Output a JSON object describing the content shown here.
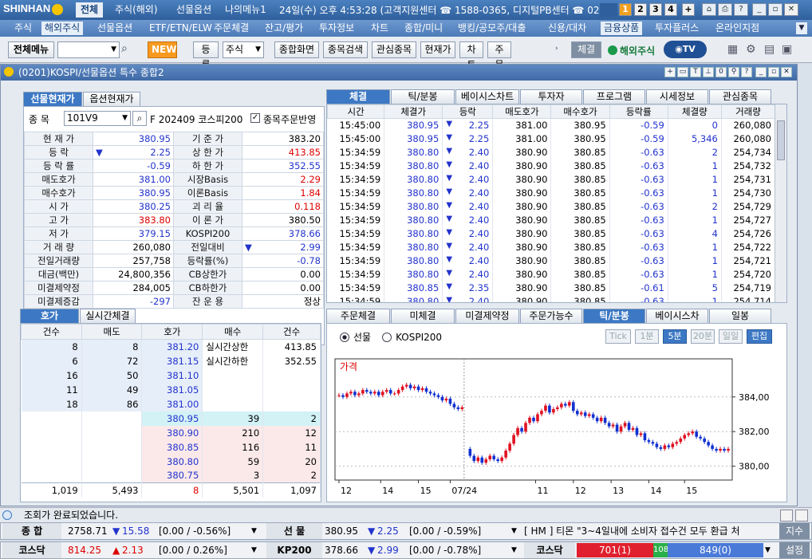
{
  "app": {
    "logo": "SHINHAN",
    "tabs": [
      "전체",
      "주식(해외)",
      "선물옵션",
      "나의메뉴1"
    ],
    "info": "24일(수) 오후 4:53:28 (고객지원센터 ☎ 1588-0365, 디지털PB센터 ☎ 02",
    "pages": [
      "1",
      "2",
      "3",
      "4",
      "+"
    ]
  },
  "menu": [
    "주식",
    "해외주식",
    "선물옵션",
    "ETF/ETN/ELW",
    "주문체결",
    "잔고/평가",
    "투자정보",
    "차트",
    "종합/미니",
    "뱅킹/공모주/대출",
    "신용/대차",
    "금융상품",
    "투자플러스",
    "온라인지점"
  ],
  "toolbar": {
    "all_menu": "전체메뉴",
    "new": "NEW",
    "buttons": [
      "등록",
      "주식",
      "종합화면",
      "종목검색",
      "관심종목",
      "현재가",
      "차트",
      "주문"
    ],
    "right": [
      "체결",
      "해외주식"
    ]
  },
  "window": {
    "title": "(0201)KOSPI/선물옵션 특수 종합2"
  },
  "quote": {
    "tabs": [
      "선물현재가",
      "옵션현재가"
    ],
    "code_label": "종 목",
    "code": "101V9",
    "name": "F 202409 코스피200",
    "checkbox": "종목주문반영",
    "rows": [
      [
        "현 재 가",
        "380.95",
        "dn",
        "기 준 가",
        "383.20",
        ""
      ],
      [
        "등   락",
        "2.25",
        "dn",
        "상 한 가",
        "413.85",
        "up"
      ],
      [
        "등 락 률",
        "-0.59",
        "dn",
        "하 한 가",
        "352.55",
        "dn"
      ],
      [
        "매도호가",
        "381.00",
        "dn",
        "시장Basis",
        "2.29",
        "up"
      ],
      [
        "매수호가",
        "380.95",
        "dn",
        "이론Basis",
        "1.84",
        "up"
      ],
      [
        "시   가",
        "380.25",
        "dn",
        "괴 리 율",
        "0.118",
        "up"
      ],
      [
        "고   가",
        "383.80",
        "up",
        "이 론 가",
        "380.50",
        ""
      ],
      [
        "저   가",
        "379.15",
        "dn",
        "KOSPI200",
        "378.66",
        "dn"
      ],
      [
        "거 래 량",
        "260,080",
        "",
        "전일대비",
        "2.99",
        "dn"
      ],
      [
        "전일거래량",
        "257,758",
        "",
        "등락률(%)",
        "-0.78",
        "dn"
      ],
      [
        "대금(백만)",
        "24,800,356",
        "",
        "CB상한가",
        "0.00",
        ""
      ],
      [
        "미결제약정",
        "284,005",
        "",
        "CB하한가",
        "0.00",
        ""
      ],
      [
        "미결제증감",
        "-297",
        "dn",
        "잔 운 용",
        "정상",
        ""
      ]
    ]
  },
  "ticks": {
    "tabs": [
      "체결",
      "틱/분봉",
      "베이시스차트",
      "투자자",
      "프로그램",
      "시세정보",
      "관심종목"
    ],
    "headers": [
      "시간",
      "체결가",
      "등락",
      "매도호가",
      "매수호가",
      "등락률",
      "체결량",
      "거래량"
    ],
    "rows": [
      [
        "15:45:00",
        "380.95",
        "2.25",
        "381.00",
        "380.95",
        "-0.59",
        "0",
        "260,080"
      ],
      [
        "15:45:00",
        "380.95",
        "2.25",
        "381.00",
        "380.95",
        "-0.59",
        "5,346",
        "260,080"
      ],
      [
        "15:34:59",
        "380.80",
        "2.40",
        "380.90",
        "380.85",
        "-0.63",
        "2",
        "254,734"
      ],
      [
        "15:34:59",
        "380.80",
        "2.40",
        "380.90",
        "380.85",
        "-0.63",
        "1",
        "254,732"
      ],
      [
        "15:34:59",
        "380.80",
        "2.40",
        "380.90",
        "380.85",
        "-0.63",
        "1",
        "254,731"
      ],
      [
        "15:34:59",
        "380.80",
        "2.40",
        "380.90",
        "380.85",
        "-0.63",
        "1",
        "254,730"
      ],
      [
        "15:34:59",
        "380.80",
        "2.40",
        "380.90",
        "380.85",
        "-0.63",
        "2",
        "254,729"
      ],
      [
        "15:34:59",
        "380.80",
        "2.40",
        "380.90",
        "380.85",
        "-0.63",
        "1",
        "254,727"
      ],
      [
        "15:34:59",
        "380.80",
        "2.40",
        "380.90",
        "380.85",
        "-0.63",
        "4",
        "254,726"
      ],
      [
        "15:34:59",
        "380.80",
        "2.40",
        "380.90",
        "380.85",
        "-0.63",
        "1",
        "254,722"
      ],
      [
        "15:34:59",
        "380.80",
        "2.40",
        "380.90",
        "380.85",
        "-0.63",
        "1",
        "254,721"
      ],
      [
        "15:34:59",
        "380.80",
        "2.40",
        "380.90",
        "380.85",
        "-0.63",
        "1",
        "254,720"
      ],
      [
        "15:34:59",
        "380.85",
        "2.35",
        "380.90",
        "380.85",
        "-0.61",
        "5",
        "254,719"
      ],
      [
        "15:34:59",
        "380.80",
        "2.40",
        "380.90",
        "380.85",
        "-0.63",
        "1",
        "254,714"
      ]
    ]
  },
  "orderbook": {
    "tabs": [
      "호가",
      "실시간체결"
    ],
    "headers": [
      "건수",
      "매도",
      "호가",
      "매수",
      "건수"
    ],
    "asks": [
      [
        "8",
        "8",
        "381.20"
      ],
      [
        "6",
        "72",
        "381.15"
      ],
      [
        "16",
        "50",
        "381.10"
      ],
      [
        "11",
        "49",
        "381.05"
      ],
      [
        "18",
        "86",
        "381.00"
      ]
    ],
    "ask_notes": [
      "실시간상한",
      "413.85",
      "실시간하한",
      "352.55"
    ],
    "bids": [
      [
        "380.95",
        "39",
        "2"
      ],
      [
        "380.90",
        "210",
        "12"
      ],
      [
        "380.85",
        "116",
        "11"
      ],
      [
        "380.80",
        "59",
        "20"
      ],
      [
        "380.75",
        "3",
        "2"
      ]
    ],
    "totals": [
      "1,019",
      "5,493",
      "8",
      "5,501",
      "1,097"
    ]
  },
  "chart": {
    "tabs": [
      "주문체결",
      "미체결",
      "미결제약정",
      "주문가능수량",
      "틱/분봉",
      "베이시스차트",
      "일봉"
    ],
    "radio": [
      "선물",
      "KOSPI200"
    ],
    "intervals": [
      "Tick",
      "1분",
      "5분",
      "20분",
      "일일",
      "편집"
    ],
    "title": "가격",
    "x_labels": [
      "12",
      "14",
      "15",
      "07/24",
      "11",
      "12",
      "13",
      "14",
      "15"
    ]
  },
  "chart_data": {
    "type": "candlestick",
    "title": "가격",
    "y_ticks": [
      380.0,
      382.0,
      384.0
    ],
    "ylim": [
      379.2,
      386.2
    ],
    "x_labels": [
      "12",
      "14",
      "15",
      "07/24",
      "11",
      "12",
      "13",
      "14",
      "15"
    ],
    "series": [
      {
        "name": "가격",
        "values": [
          384.1,
          384.0,
          384.2,
          384.3,
          384.1,
          384.2,
          384.4,
          384.3,
          384.2,
          384.3,
          384.1,
          384.3,
          384.4,
          384.2,
          384.2,
          384.4,
          384.6,
          384.7,
          384.5,
          384.6,
          384.4,
          384.5,
          384.3,
          384.2,
          384.1,
          384.0,
          383.8,
          383.9,
          383.6,
          383.4,
          383.3,
          383.4,
          381.0,
          380.6,
          380.3,
          380.5,
          380.2,
          380.4,
          380.6,
          380.4,
          380.3,
          380.5,
          380.9,
          381.3,
          381.8,
          382.2,
          382.0,
          382.5,
          382.8,
          382.6,
          383.0,
          383.2,
          383.5,
          383.1,
          383.3,
          383.4,
          383.6,
          383.5,
          383.7,
          383.2,
          383.0,
          383.1,
          382.9,
          383.0,
          382.8,
          382.6,
          382.8,
          382.5,
          382.3,
          382.4,
          382.0,
          382.3,
          382.5,
          382.1,
          382.2,
          381.8,
          381.9,
          381.5,
          381.4,
          381.3,
          381.1,
          381.0,
          381.2,
          381.1,
          381.3,
          381.4,
          381.6,
          381.8,
          381.9,
          382.0,
          381.7,
          381.6,
          381.4,
          381.2,
          381.0,
          380.9,
          381.0,
          380.9,
          381.0
        ]
      }
    ]
  },
  "status": {
    "message": "조회가 완료되었습니다."
  },
  "ticker": {
    "items": [
      {
        "label": "종  합",
        "value": "2758.71",
        "dir": "▼",
        "chg": "15.58",
        "range": "[0.00 / -0.56%]",
        "cls": "dn"
      },
      {
        "label": "선  물",
        "value": "380.95",
        "dir": "▼",
        "chg": "2.25",
        "range": "[0.00 / -0.59%]",
        "cls": "dn"
      },
      {
        "label": "코스닥",
        "value": "814.25",
        "dir": "▲",
        "chg": "2.13",
        "range": "[0.00 / 0.26%]",
        "cls": "up"
      },
      {
        "label": "KP200",
        "value": "378.66",
        "dir": "▼",
        "chg": "2.99",
        "range": "[0.00 / -0.78%]",
        "cls": "dn"
      }
    ],
    "news": "[ HM ] 티몬 \"3~4일내에 소비자 접수건 모두 환급 처",
    "news_btn": "지수",
    "kosdaq_label": "코스닥",
    "breadth": [
      "701(1)",
      "108",
      "849(0)"
    ],
    "settings": "설정"
  },
  "colors": {
    "up": "#d00000",
    "down": "#2233cc",
    "accent": "#3c78c4"
  }
}
